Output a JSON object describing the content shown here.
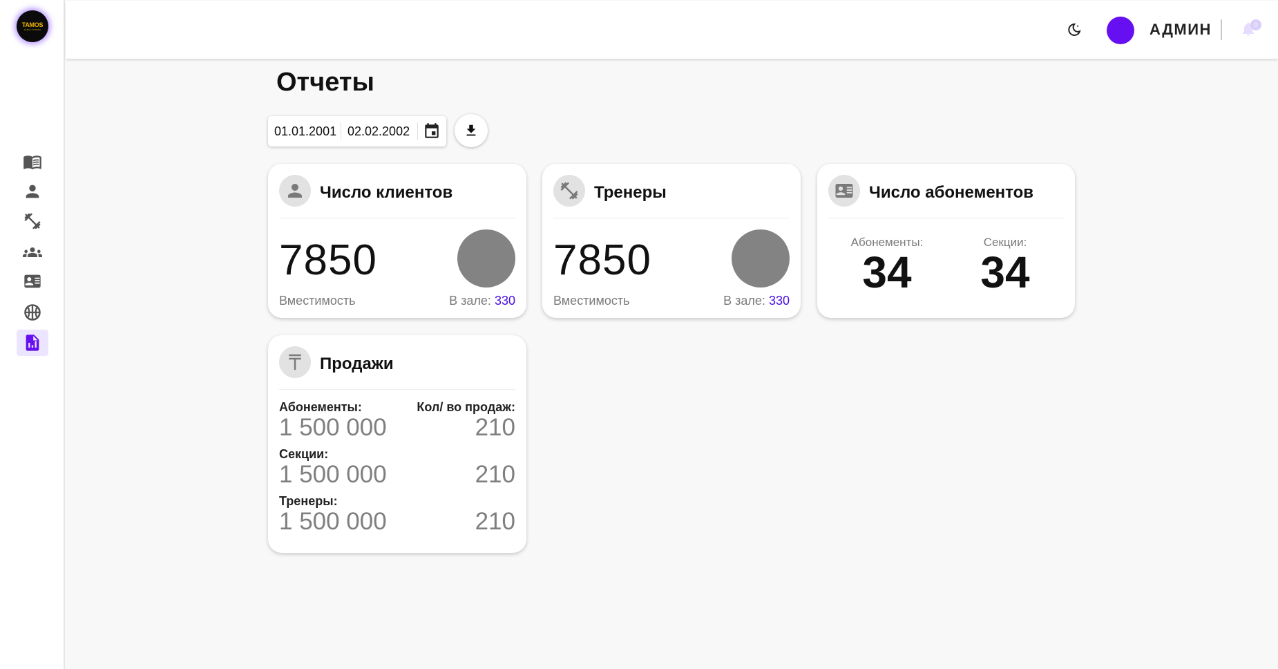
{
  "logo": {
    "text": "TAMOS",
    "subtext": "FAMILY FITNESS"
  },
  "sidebar": {
    "items": [
      {
        "name": "journal",
        "icon": "open-book-icon"
      },
      {
        "name": "clients",
        "icon": "person-icon"
      },
      {
        "name": "trainers",
        "icon": "dumbbell-icon"
      },
      {
        "name": "groups",
        "icon": "group-icon"
      },
      {
        "name": "subscriptions",
        "icon": "id-card-icon"
      },
      {
        "name": "sections",
        "icon": "basketball-icon"
      },
      {
        "name": "reports",
        "icon": "report-icon",
        "active": true
      }
    ]
  },
  "header": {
    "user_name": "АДМИН",
    "notifications_count": "0",
    "accent_color": "#6610f2"
  },
  "page": {
    "title": "Отчеты"
  },
  "filters": {
    "date_from": "01.01.2001",
    "date_to": "02.02.2002"
  },
  "cards": {
    "clients": {
      "title": "Число клиентов",
      "value": "7850",
      "capacity_label": "Вместимость",
      "in_gym_label": "В зале:",
      "in_gym_value": "330"
    },
    "trainers": {
      "title": "Тренеры",
      "value": "7850",
      "capacity_label": "Вместимость",
      "in_gym_label": "В зале:",
      "in_gym_value": "330"
    },
    "subscriptions": {
      "title": "Число абонементов",
      "col1_label": "Абонементы:",
      "col1_value": "34",
      "col2_label": "Секции:",
      "col2_value": "34"
    },
    "sales": {
      "title": "Продажи",
      "count_header": "Кол/ во продаж:",
      "rows": [
        {
          "label": "Абонементы:",
          "amount": "1 500 000",
          "count": "210"
        },
        {
          "label": "Секции:",
          "amount": "1 500 000",
          "count": "210"
        },
        {
          "label": "Тренеры:",
          "amount": "1 500 000",
          "count": "210"
        }
      ]
    }
  }
}
